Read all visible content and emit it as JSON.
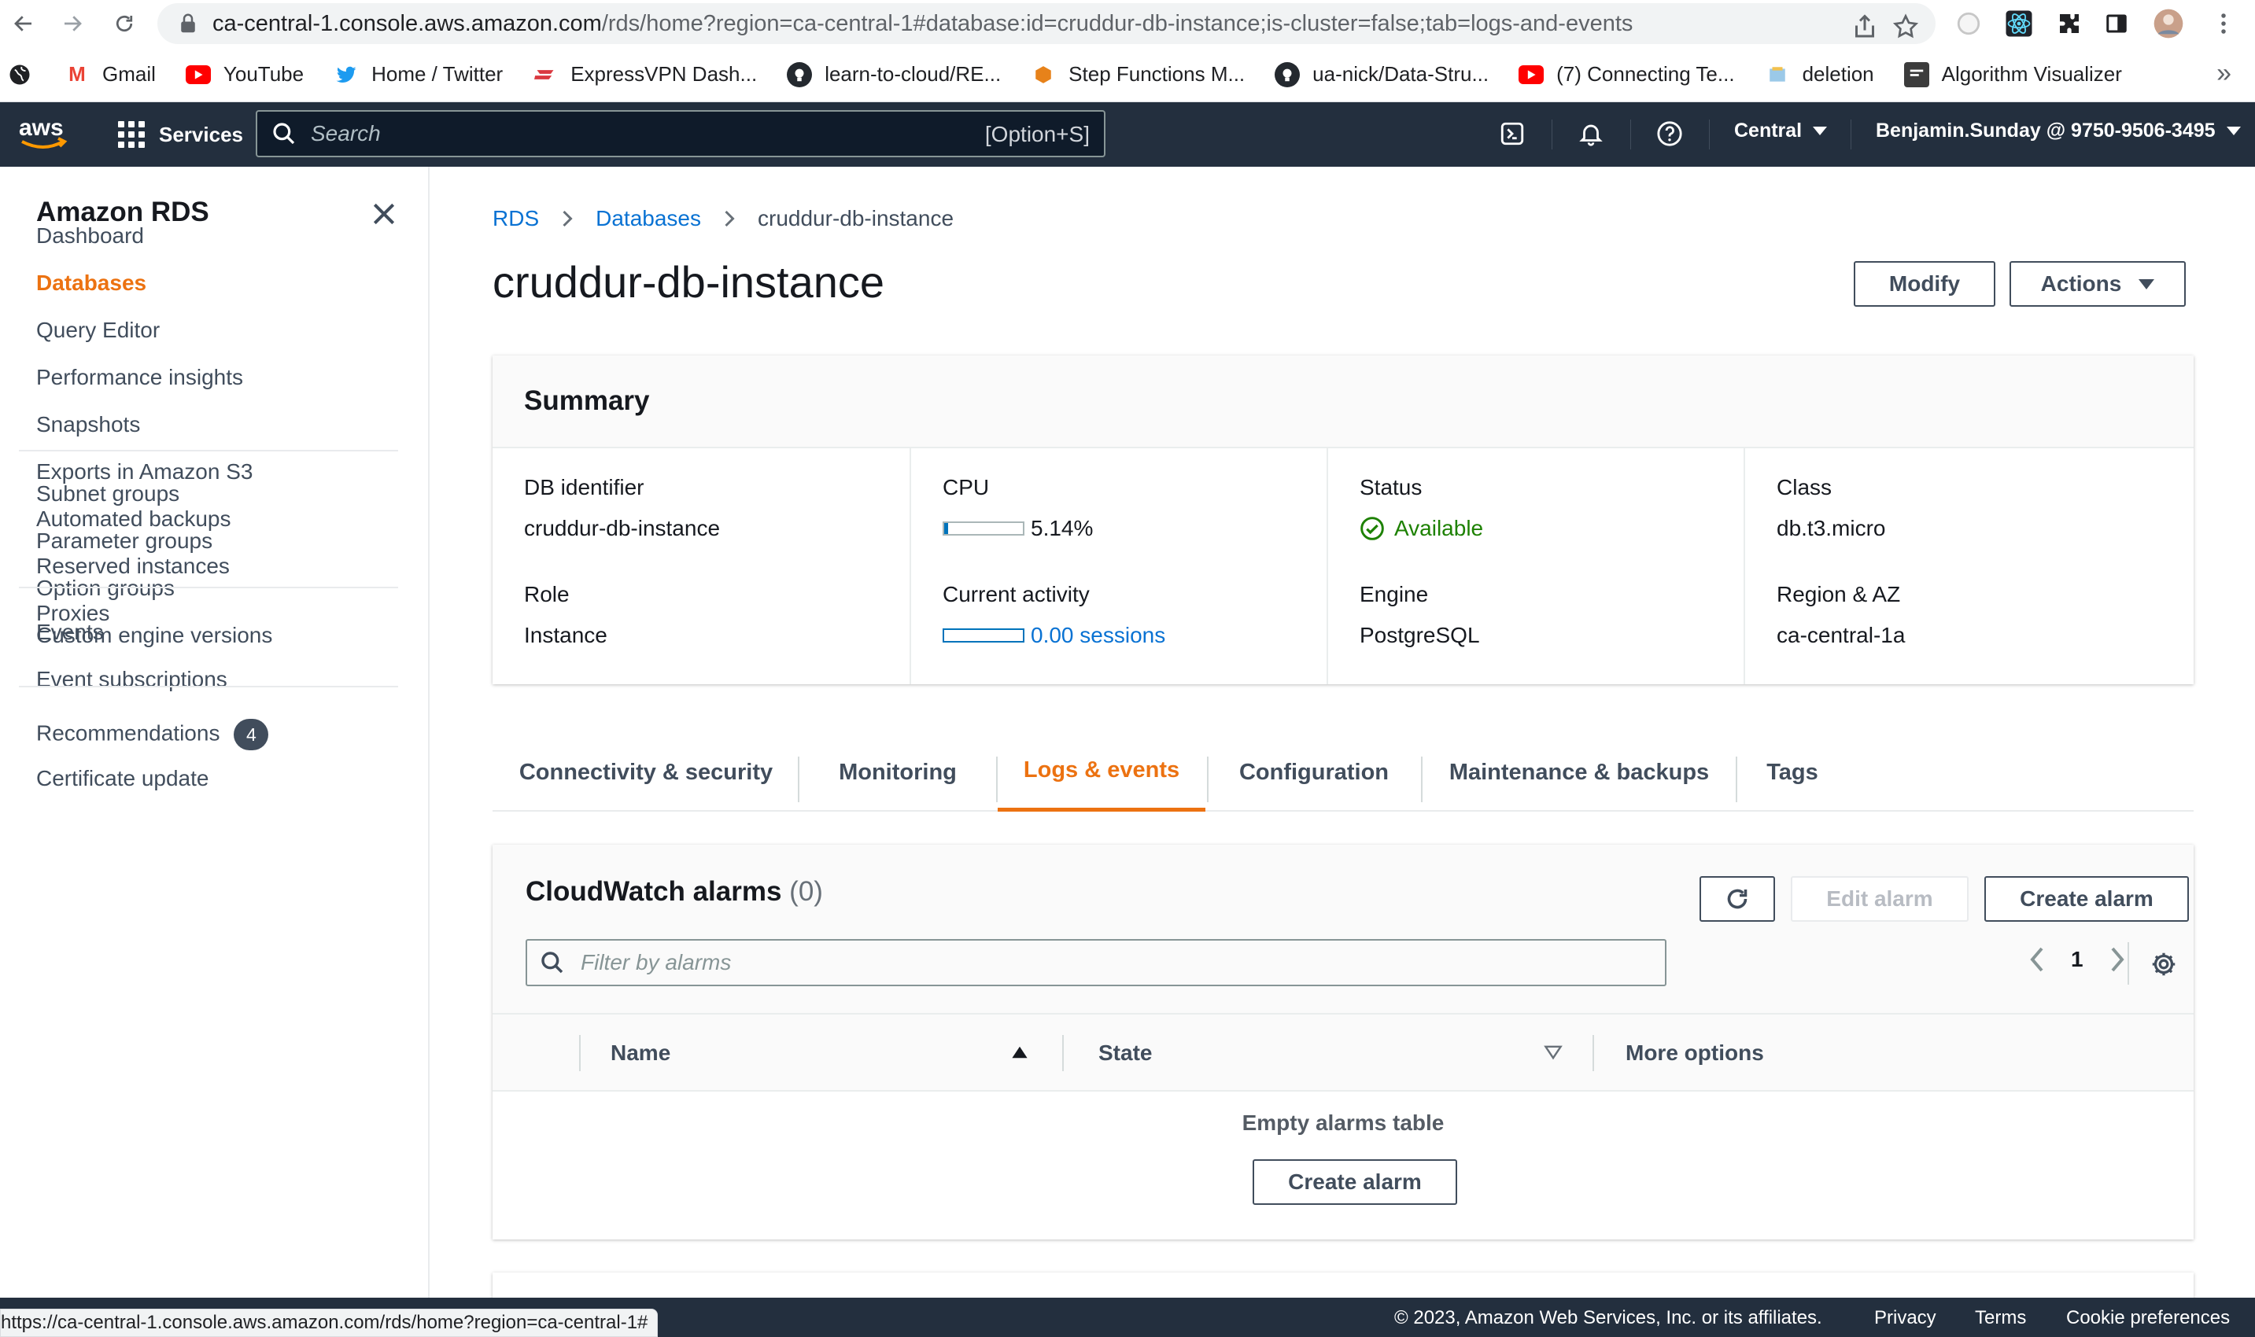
{
  "browser": {
    "url_host": "ca-central-1.console.aws.amazon.com",
    "url_path": "/rds/home?region=ca-central-1#database:id=cruddur-db-instance;is-cluster=false;tab=logs-and-events",
    "bookmarks": [
      {
        "label": "Gmail",
        "icon": "gmail-icon",
        "color": "#ea4335"
      },
      {
        "label": "YouTube",
        "icon": "youtube-icon",
        "color": "#ff0000"
      },
      {
        "label": "Home / Twitter",
        "icon": "twitter-icon",
        "color": "#1d9bf0"
      },
      {
        "label": "ExpressVPN Dash...",
        "icon": "expressvpn-icon",
        "color": "#da3940"
      },
      {
        "label": "learn-to-cloud/RE...",
        "icon": "github-icon",
        "color": "#24292f"
      },
      {
        "label": "Step Functions M...",
        "icon": "step-functions-icon",
        "color": "#e7821a"
      },
      {
        "label": "ua-nick/Data-Stru...",
        "icon": "github-icon",
        "color": "#24292f"
      },
      {
        "label": "(7) Connecting Te...",
        "icon": "youtube-icon",
        "color": "#ff0000"
      },
      {
        "label": "deletion",
        "icon": "bookmark-folder-icon",
        "color": "#f2c14e"
      },
      {
        "label": "Algorithm Visualizer",
        "icon": "algorithm-visualizer-icon",
        "color": "#3c3c3c"
      }
    ],
    "more": "»",
    "status_url": "https://ca-central-1.console.aws.amazon.com/rds/home?region=ca-central-1#"
  },
  "topnav": {
    "logo": "aws",
    "services_label": "Services",
    "search_placeholder": "Search",
    "search_shortcut": "[Option+S]",
    "region_label": "Central",
    "account_label": "Benjamin.Sunday @ 9750-9506-3495"
  },
  "sidebar": {
    "title": "Amazon RDS",
    "groups": [
      [
        "Dashboard",
        "Databases",
        "Query Editor",
        "Performance insights",
        "Snapshots",
        "Exports in Amazon S3",
        "Automated backups",
        "Reserved instances",
        "Proxies"
      ],
      [
        "Subnet groups",
        "Parameter groups",
        "Option groups",
        "Custom engine versions"
      ],
      [
        "Events",
        "Event subscriptions"
      ],
      [
        "Recommendations",
        "Certificate update"
      ]
    ],
    "active_item": "Databases",
    "recommendations_badge": "4"
  },
  "breadcrumb": {
    "items": [
      "RDS",
      "Databases"
    ],
    "current": "cruddur-db-instance"
  },
  "page": {
    "title": "cruddur-db-instance",
    "modify_label": "Modify",
    "actions_label": "Actions"
  },
  "summary": {
    "title": "Summary",
    "db_identifier_label": "DB identifier",
    "db_identifier": "cruddur-db-instance",
    "role_label": "Role",
    "role": "Instance",
    "cpu_label": "CPU",
    "cpu_value": "5.14%",
    "cpu_fraction": 0.0514,
    "activity_label": "Current activity",
    "activity_value": "0.00 sessions",
    "activity_fraction": 0,
    "status_label": "Status",
    "status_value": "Available",
    "status_color": "#1d8102",
    "engine_label": "Engine",
    "engine_value": "PostgreSQL",
    "class_label": "Class",
    "class_value": "db.t3.micro",
    "region_label": "Region & AZ",
    "region_value": "ca-central-1a"
  },
  "tabs": {
    "items": [
      "Connectivity & security",
      "Monitoring",
      "Logs & events",
      "Configuration",
      "Maintenance & backups",
      "Tags"
    ],
    "active": "Logs & events"
  },
  "alarms": {
    "title": "CloudWatch alarms",
    "count": "(0)",
    "edit_label": "Edit alarm",
    "create_label": "Create alarm",
    "filter_placeholder": "Filter by alarms",
    "page_number": "1",
    "columns": [
      "Name",
      "State",
      "More options"
    ],
    "empty_text": "Empty alarms table",
    "empty_create_label": "Create alarm"
  },
  "footer": {
    "copyright": "© 2023, Amazon Web Services, Inc. or its affiliates.",
    "privacy": "Privacy",
    "terms": "Terms",
    "cookies": "Cookie preferences"
  },
  "colors": {
    "aws_nav": "#232f3e",
    "accent": "#ec7211",
    "link": "#0972d3"
  }
}
